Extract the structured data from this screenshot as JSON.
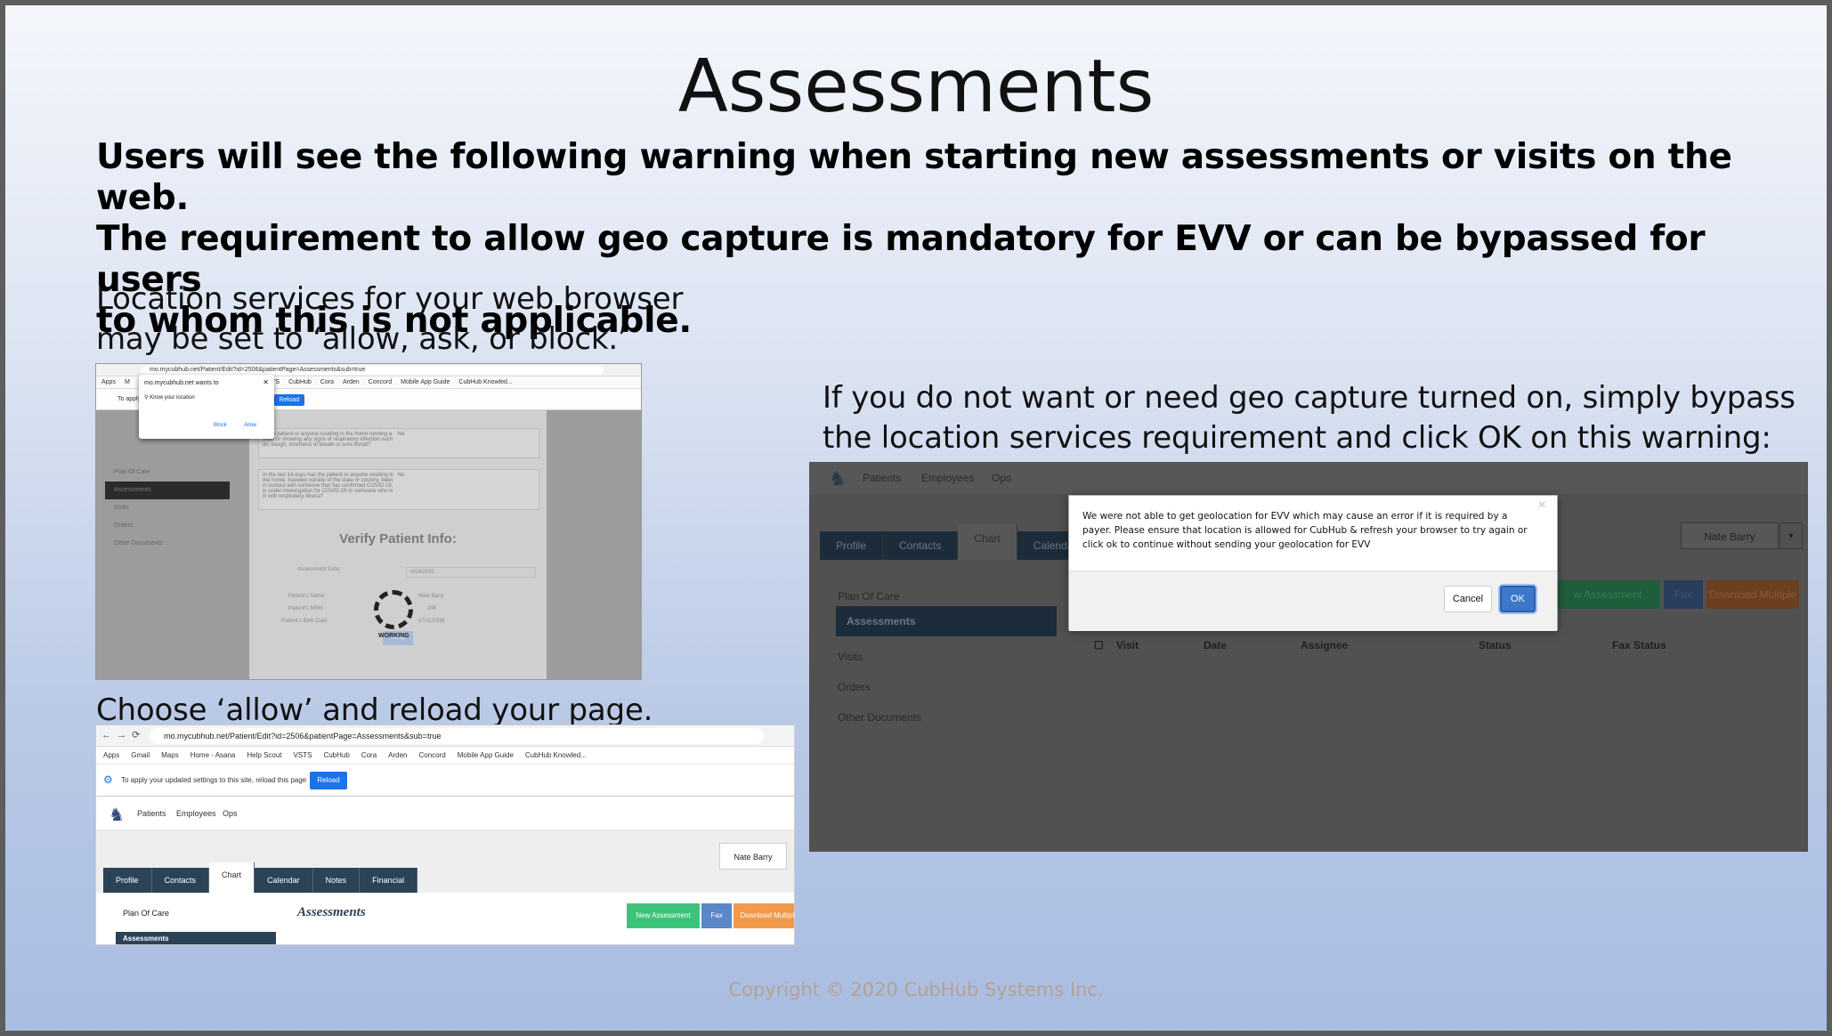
{
  "slide": {
    "title": "Assessments",
    "intro_line1": "Users will see the following warning when starting new assessments or visits on the web.",
    "intro_line2": "The requirement to allow geo capture is mandatory for EVV or can be bypassed for users",
    "intro_line3": "to whom this is not applicable.",
    "location_line1": "Location services for your web browser",
    "location_line2": "may be set to ‘allow, ask, or block.’",
    "choose_text": "Choose ‘allow’ and reload your page.",
    "bypass_line1": "If you do not want or need geo capture turned on, simply bypass",
    "bypass_line2": "the location services requirement and click OK on this warning:",
    "copyright": "Copyright © 2020 CubHub Systems Inc."
  },
  "shot1": {
    "url": "mo.mycubhub.net/Patient/Edit?id=2506&patientPage=Assessments&sub=true",
    "bookmarks": [
      "Apps",
      "M",
      "VSTS",
      "CubHub",
      "Cora",
      "Arden",
      "Concord",
      "Mobile App Guide",
      "CubHub Knowled..."
    ],
    "info_text": "To apply",
    "reload_label": "Reload",
    "popup_title": "mo.mycubhub.net wants to",
    "popup_location": "Know your location",
    "popup_block": "Block",
    "popup_allow": "Allow",
    "sidebar": [
      "Plan Of Care",
      "Assessments",
      "Visits",
      "Orders",
      "Other Documents"
    ],
    "question1": "Is the patient or anyone residing in the home running a fever or showing any signs of respiratory infection such as, cough, shortness of breath or sore throat?",
    "question1_answer": "No",
    "question2": "In the last 14 days has the patient or anyone residing in the home, traveled outside of the state or country, been in contact with someone that has confirmed COVID-19, is under investigation for COVID-19 or someone who is ill with respiratory illness?",
    "question2_answer": "No",
    "verify_title": "Verify Patient Info:",
    "assessment_date_label": "Assessment Date:",
    "assessment_date_value": "4/14/2020",
    "name_label": "Patient's Name:",
    "name_value": "Nate Barry",
    "mrn_label": "Patient's MRN:",
    "mrn_value": "246",
    "birth_label": "Patient's Birth Date:",
    "birth_value": "07/11/1938",
    "verify_button": "Verify",
    "working_text": "WORKING"
  },
  "shot2": {
    "url": "mo.mycubhub.net/Patient/Edit?id=2506&patientPage=Assessments&sub=true",
    "bookmarks": [
      "Apps",
      "Gmail",
      "Maps",
      "Home - Asana",
      "Help Scout",
      "VSTS",
      "CubHub",
      "Cora",
      "Arden",
      "Concord",
      "Mobile App Guide",
      "CubHub Knowled..."
    ],
    "info_text": "To apply your updated settings to this site, reload this page",
    "reload_label": "Reload",
    "nav": [
      "Patients",
      "Employees",
      "Ops"
    ],
    "tabs": [
      "Profile",
      "Contacts",
      "Chart",
      "Calendar",
      "Notes",
      "Financial"
    ],
    "user": "Nate Barry",
    "plan_of_care": "Plan Of Care",
    "assessments_item": "Assessments",
    "heading": "Assessments",
    "new_assessment": "New Assessment",
    "fax": "Fax",
    "download_multiple": "Download Multiple"
  },
  "shot3": {
    "nav": [
      "Patients",
      "Employees",
      "Ops"
    ],
    "tabs": [
      "Profile",
      "Contacts",
      "Chart",
      "Calenda"
    ],
    "user": "Nate Barry",
    "sidebar": [
      "Plan Of Care",
      "Assessments",
      "Visits",
      "Orders",
      "Other Documents"
    ],
    "buttons": [
      "w Assessment",
      "Fax",
      "Download Multiple"
    ],
    "columns": [
      "Visit",
      "Date",
      "Assignee",
      "Status",
      "Fax Status"
    ],
    "dialog_message": "We were not able to get geolocation for EVV which may cause an error if it is required by a payer. Please ensure that location is allowed for CubHub & refresh your browser to try again or click ok to continue without sending your geolocation for EVV",
    "cancel_label": "Cancel",
    "ok_label": "OK"
  }
}
